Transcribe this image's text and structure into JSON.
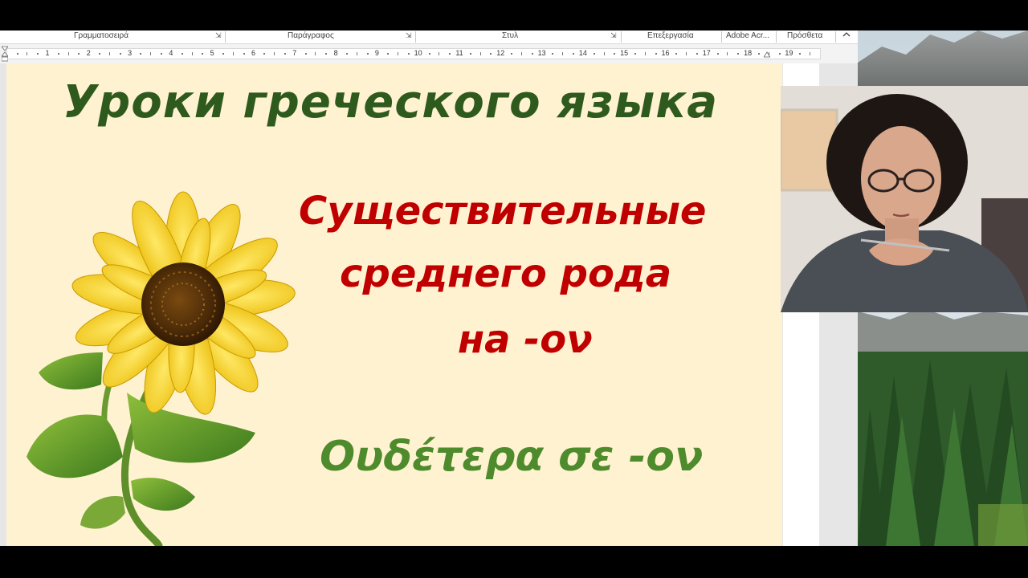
{
  "ribbon": {
    "groups": [
      {
        "label": "Γραμματοσειρά"
      },
      {
        "label": "Παράγραφος"
      },
      {
        "label": "Στυλ"
      },
      {
        "label": "Επεξεργασία"
      },
      {
        "label": "Adobe Acr..."
      },
      {
        "label": "Πρόσθετα"
      }
    ],
    "collapse_icon": "chevron-up-icon"
  },
  "ruler": {
    "labels": [
      "1",
      "2",
      "3",
      "4",
      "5",
      "6",
      "7",
      "8",
      "9",
      "10",
      "11",
      "12",
      "13",
      "14",
      "15",
      "16",
      "17",
      "18",
      "19"
    ]
  },
  "slide": {
    "title": "Уроки  греческого  языка",
    "subtitle_lines": [
      "Существительные",
      "среднего  рода",
      "на -ον"
    ],
    "greek_line": "Ουδέτερα  σε -ον",
    "colors": {
      "background": "#fff2d1",
      "title": "#2e5a1e",
      "subtitle": "#c00000",
      "greek": "#4e8b2c"
    }
  }
}
